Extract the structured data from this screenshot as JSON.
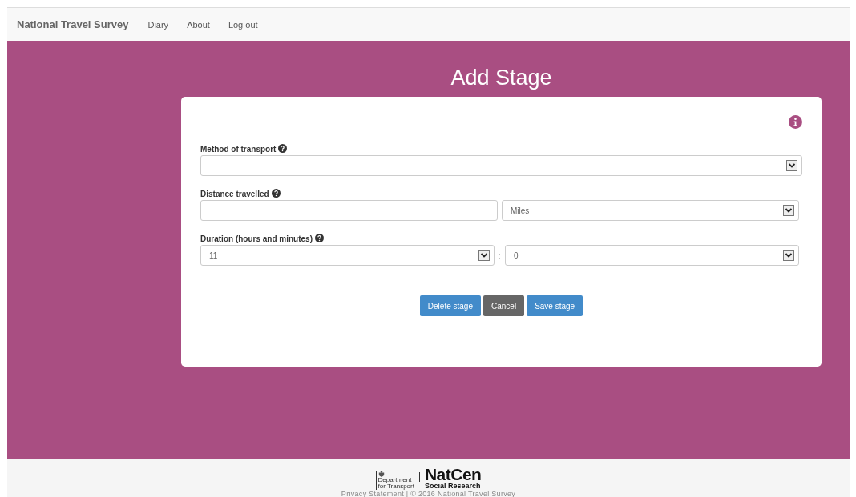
{
  "nav": {
    "brand": "National Travel Survey",
    "links": [
      "Diary",
      "About",
      "Log out"
    ]
  },
  "title": "Add Stage",
  "fields": [
    {
      "label": "Method of transport",
      "controls": [
        {
          "kind": "select"
        }
      ]
    },
    {
      "label": "Distance travelled",
      "controls": [
        {
          "kind": "input"
        },
        {
          "kind": "select",
          "value": "Miles"
        }
      ]
    },
    {
      "label": "Duration (hours and minutes)",
      "controls": [
        {
          "kind": "select",
          "value": "11"
        },
        {
          "kind": "separator",
          "text": ":"
        },
        {
          "kind": "select",
          "value": "0"
        }
      ]
    }
  ],
  "buttons": [
    {
      "label": "Delete stage",
      "kind": "primary"
    },
    {
      "label": "Cancel",
      "kind": "secondary"
    },
    {
      "label": "Save stage",
      "kind": "primary"
    }
  ],
  "footer": {
    "dft": [
      "Department",
      "for Transport"
    ],
    "natcen": [
      "NatCen",
      "Social Research"
    ],
    "text": "Privacy Statement | © 2016 National Travel Survey"
  }
}
